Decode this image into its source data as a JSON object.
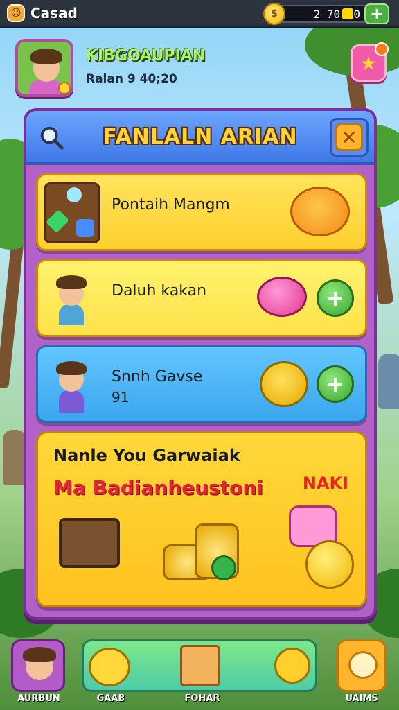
{
  "topbar": {
    "title": "Casad",
    "currency_value": "2 70 10",
    "coin_icon": "coin-icon",
    "plus_label": "+"
  },
  "player": {
    "name": "KIBGOAUPIAN",
    "subtitle": "Ralan 9 40;20"
  },
  "panel": {
    "title": "FANLALN ARIAN",
    "close_label": "✕"
  },
  "cards": [
    {
      "label": "Pontaih Mangm",
      "sublabel": ""
    },
    {
      "label": "Daluh kakan",
      "sublabel": ""
    },
    {
      "label": "Snnh Gavse",
      "sublabel": "91"
    }
  ],
  "feature": {
    "title": "Nanle You Garwaiak",
    "promo": "Ma Badianheustoni",
    "tag": "NAKI"
  },
  "nav": {
    "items": [
      {
        "label": "AURBUN"
      },
      {
        "label": "GAAB"
      },
      {
        "label": "FOHAR"
      },
      {
        "label": "UAIMS"
      }
    ]
  },
  "colors": {
    "panel_purple": "#b261c9",
    "header_blue": "#3f78e6",
    "title_gold": "#ffd43a",
    "promo_red": "#e0243a",
    "plus_green": "#3ca632"
  }
}
